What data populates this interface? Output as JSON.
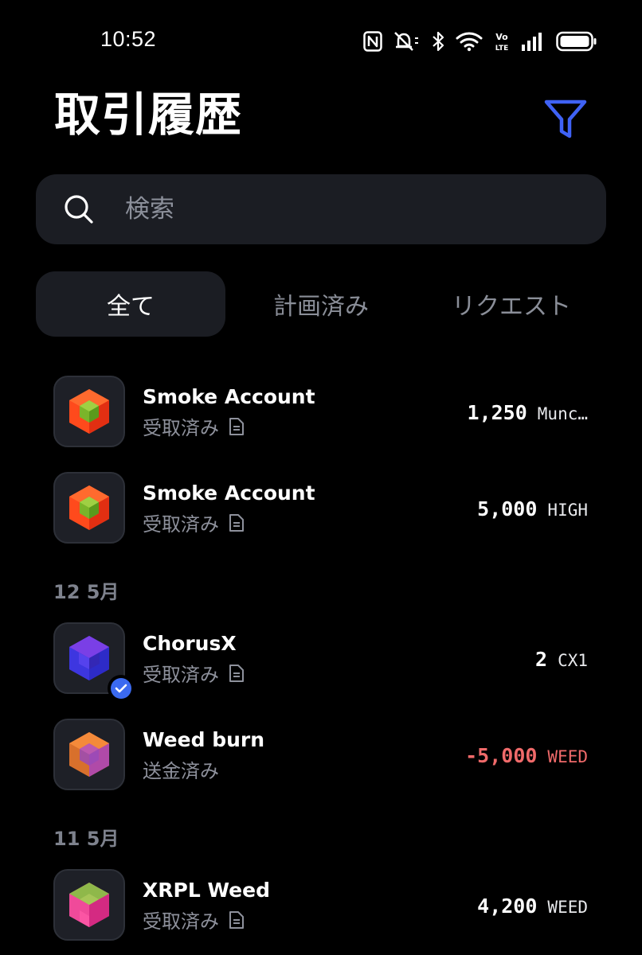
{
  "status_bar": {
    "time": "10:52",
    "icons": [
      "nfc-icon",
      "mute-icon",
      "bluetooth-icon",
      "wifi-icon",
      "volte-icon",
      "signal-icon",
      "battery-icon"
    ],
    "volte_text": "Vo LTE"
  },
  "header": {
    "title": "取引履歴",
    "filter_icon": "filter-icon",
    "accent_color": "#3f62f5"
  },
  "search": {
    "placeholder": "検索",
    "value": ""
  },
  "tabs": [
    {
      "label": "全て",
      "active": true
    },
    {
      "label": "計画済み",
      "active": false
    },
    {
      "label": "リクエスト",
      "active": false
    }
  ],
  "transactions": {
    "t0": {
      "name": "Smoke Account",
      "status": "受取済み",
      "has_memo": true,
      "amount": "1,250",
      "currency": "Munc…",
      "negative": false
    },
    "t1": {
      "name": "Smoke Account",
      "status": "受取済み",
      "has_memo": true,
      "amount": "5,000",
      "currency": "HIGH",
      "negative": false
    },
    "t2": {
      "name": "ChorusX",
      "status": "受取済み",
      "has_memo": true,
      "verified": true,
      "amount": "2",
      "currency": "CX1",
      "negative": false
    },
    "t3": {
      "name": "Weed burn",
      "status": "送金済み",
      "has_memo": false,
      "amount": "-5,000",
      "currency": "WEED",
      "negative": true
    },
    "t4": {
      "name": "XRPL Weed",
      "status": "受取済み",
      "has_memo": true,
      "amount": "4,200",
      "currency": "WEED",
      "negative": false
    }
  },
  "date_groups": {
    "g1": "12 5月",
    "g2": "11 5月"
  },
  "colors": {
    "background": "#000000",
    "surface": "#1b1d23",
    "muted_text": "#8e919c",
    "negative": "#f06a6a",
    "accent": "#3f62f5"
  }
}
